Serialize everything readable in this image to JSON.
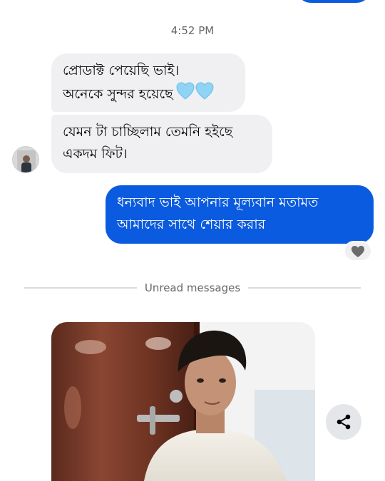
{
  "conversation": {
    "timestamp": "4:52 PM",
    "messages": [
      {
        "direction": "incoming",
        "text": "প্রোডাক্ট পেয়েছি ভাই।\nঅনেকে সুন্দর হয়েছে",
        "reaction_icons": [
          "light-blue-heart-icon",
          "light-blue-heart-icon"
        ]
      },
      {
        "direction": "incoming",
        "text": "যেমন টা চাচ্ছিলাম তেমনি হইছে\nএকদম ফিট।"
      },
      {
        "direction": "outgoing",
        "text": "ধন্যবাদ ভাই আপনার মূল্যবান মতামত\nআমাদের সাথে শেয়ার করার",
        "reaction_icon": "grey-heart-icon"
      }
    ],
    "unread_divider": "Unread messages",
    "attachment": {
      "type": "photo",
      "icon": "share-icon"
    }
  },
  "colors": {
    "outgoing_bubble": "#0a5be0",
    "incoming_bubble": "#f0f0f2",
    "meta_text": "#65676b",
    "heart_light_blue": "#8fd3f5",
    "heart_grey": "#6b6b6b"
  }
}
